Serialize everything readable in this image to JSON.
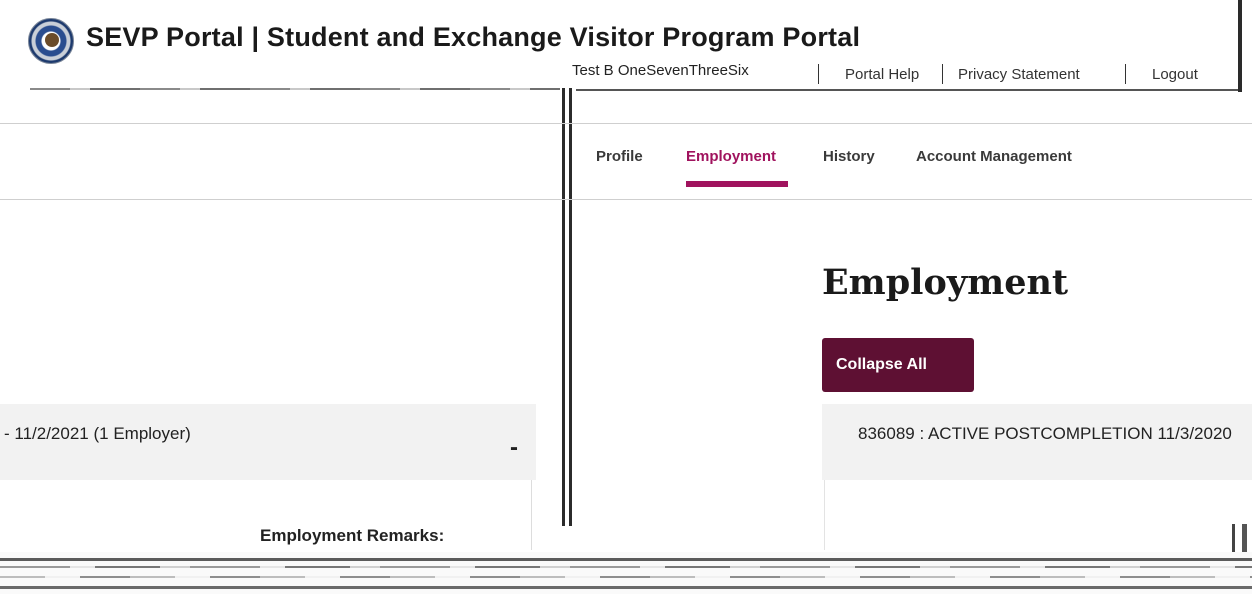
{
  "header": {
    "title": "SEVP Portal | Student and Exchange Visitor Program Portal",
    "user_name": "Test B OneSevenThreeSix",
    "links": [
      "Portal Help",
      "Privacy Statement",
      "Logout"
    ]
  },
  "nav": {
    "tabs": [
      "Profile",
      "Employment",
      "History",
      "Account Management"
    ],
    "active_tab": "Employment"
  },
  "main": {
    "page_title": "Employment",
    "collapse_button": "Collapse All",
    "left_panel": {
      "header_text": "- 11/2/2021 (1 Employer)",
      "toggle": "-",
      "remarks_label": "Employment Remarks:"
    },
    "right_panel": {
      "header_text": "836089 : ACTIVE POSTCOMPLETION 11/3/2020"
    }
  },
  "colors": {
    "accent": "#a0135e",
    "button_bg": "#5e1033",
    "panel_bg": "#f2f2f2"
  },
  "icons": {
    "seal": "dhs-seal-icon"
  }
}
